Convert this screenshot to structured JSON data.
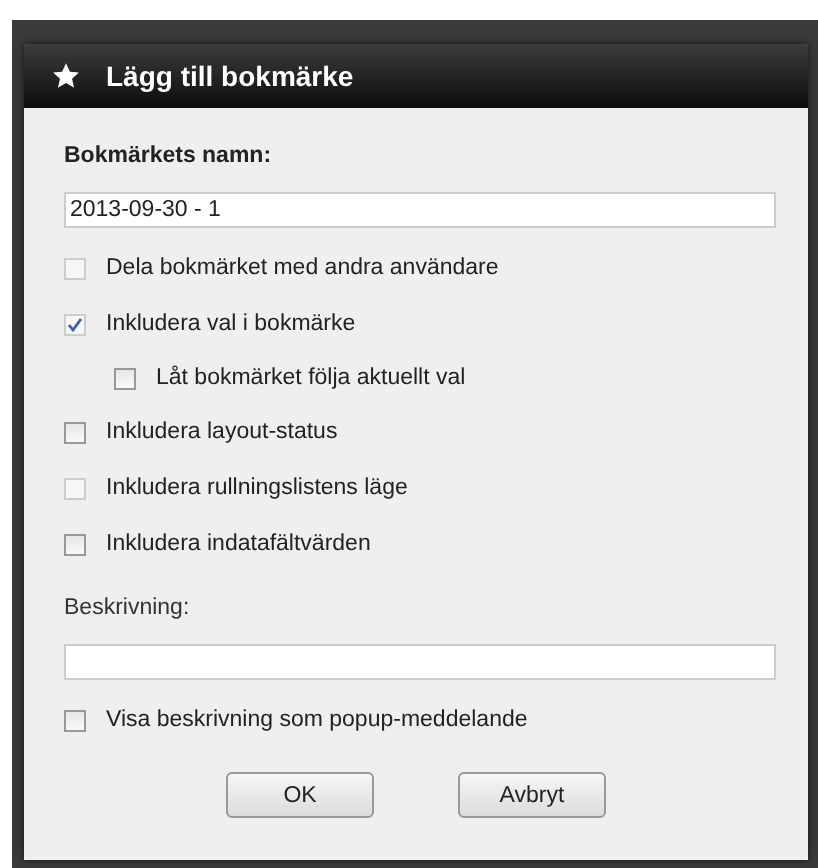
{
  "dialog": {
    "title": "Lägg till bokmärke"
  },
  "name_field": {
    "label": "Bokmärkets namn:",
    "value": "2013-09-30 - 1"
  },
  "options": [
    {
      "label": "Dela bokmärket med andra användare",
      "checked": false,
      "disabled": true
    },
    {
      "label": "Inkludera val i bokmärke",
      "checked": true,
      "disabled": true,
      "children": [
        {
          "label": "Låt bokmärket följa aktuellt val",
          "checked": false,
          "disabled": false
        }
      ]
    },
    {
      "label": "Inkludera layout-status",
      "checked": false,
      "disabled": false
    },
    {
      "label": "Inkludera rullningslistens läge",
      "checked": false,
      "disabled": true
    },
    {
      "label": "Inkludera indatafältvärden",
      "checked": false,
      "disabled": false
    }
  ],
  "description_field": {
    "label": "Beskrivning:"
  },
  "popup_option": {
    "label": "Visa beskrivning som popup-meddelande",
    "checked": false,
    "disabled": false
  },
  "buttons": [
    "OK",
    "Avbryt"
  ]
}
